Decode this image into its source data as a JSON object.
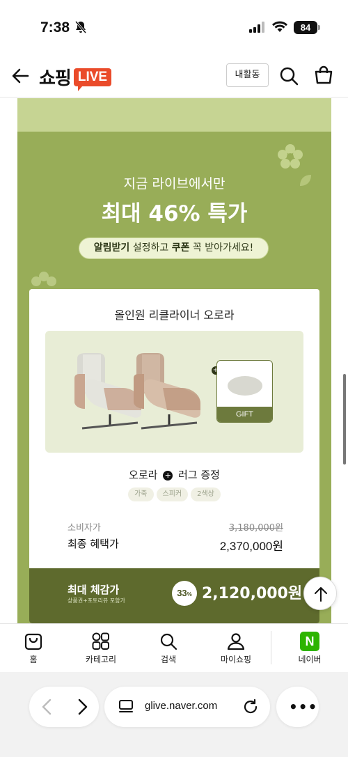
{
  "status_bar": {
    "time": "7:38",
    "battery": "84"
  },
  "header": {
    "logo_text": "쇼핑",
    "logo_badge": "LIVE",
    "activity_button": "내활동"
  },
  "promo": {
    "subtitle": "지금 라이브에서만",
    "title": "최대 46% 특가",
    "notice_bold1": "알림받기",
    "notice_mid": " 설정하고 ",
    "notice_bold2": "쿠폰",
    "notice_end": " 꼭 받아가세요!"
  },
  "product": {
    "name": "올인원 리클라이너 오로라",
    "gift_label": "GIFT",
    "line_item": "오로라",
    "line_gift": "러그 증정",
    "tags": [
      "가죽",
      "스피커",
      "2색상"
    ],
    "consumer_price_label": "소비자가",
    "consumer_price": "3,180,000원",
    "final_price_label": "최종 혜택가",
    "final_price": "2,370,000원",
    "max_label": "최대 체감가",
    "max_sub": "상품권+포토리뷰 포함가",
    "discount_rate": "33",
    "discount_unit": "%",
    "max_price": "2,120,000원"
  },
  "bottom_nav": [
    {
      "label": "홈",
      "icon": "home-bag-icon"
    },
    {
      "label": "카테고리",
      "icon": "category-grid-icon"
    },
    {
      "label": "검색",
      "icon": "search-icon"
    },
    {
      "label": "마이쇼핑",
      "icon": "person-icon"
    },
    {
      "label": "네이버",
      "icon": "naver-n-icon",
      "icon_text": "N"
    }
  ],
  "browser": {
    "url": "glive.naver.com"
  },
  "colors": {
    "promo_green": "#98ad58",
    "dark_green": "#5e6a2d",
    "live_red": "#ea4b2a",
    "naver_green": "#2db400"
  }
}
